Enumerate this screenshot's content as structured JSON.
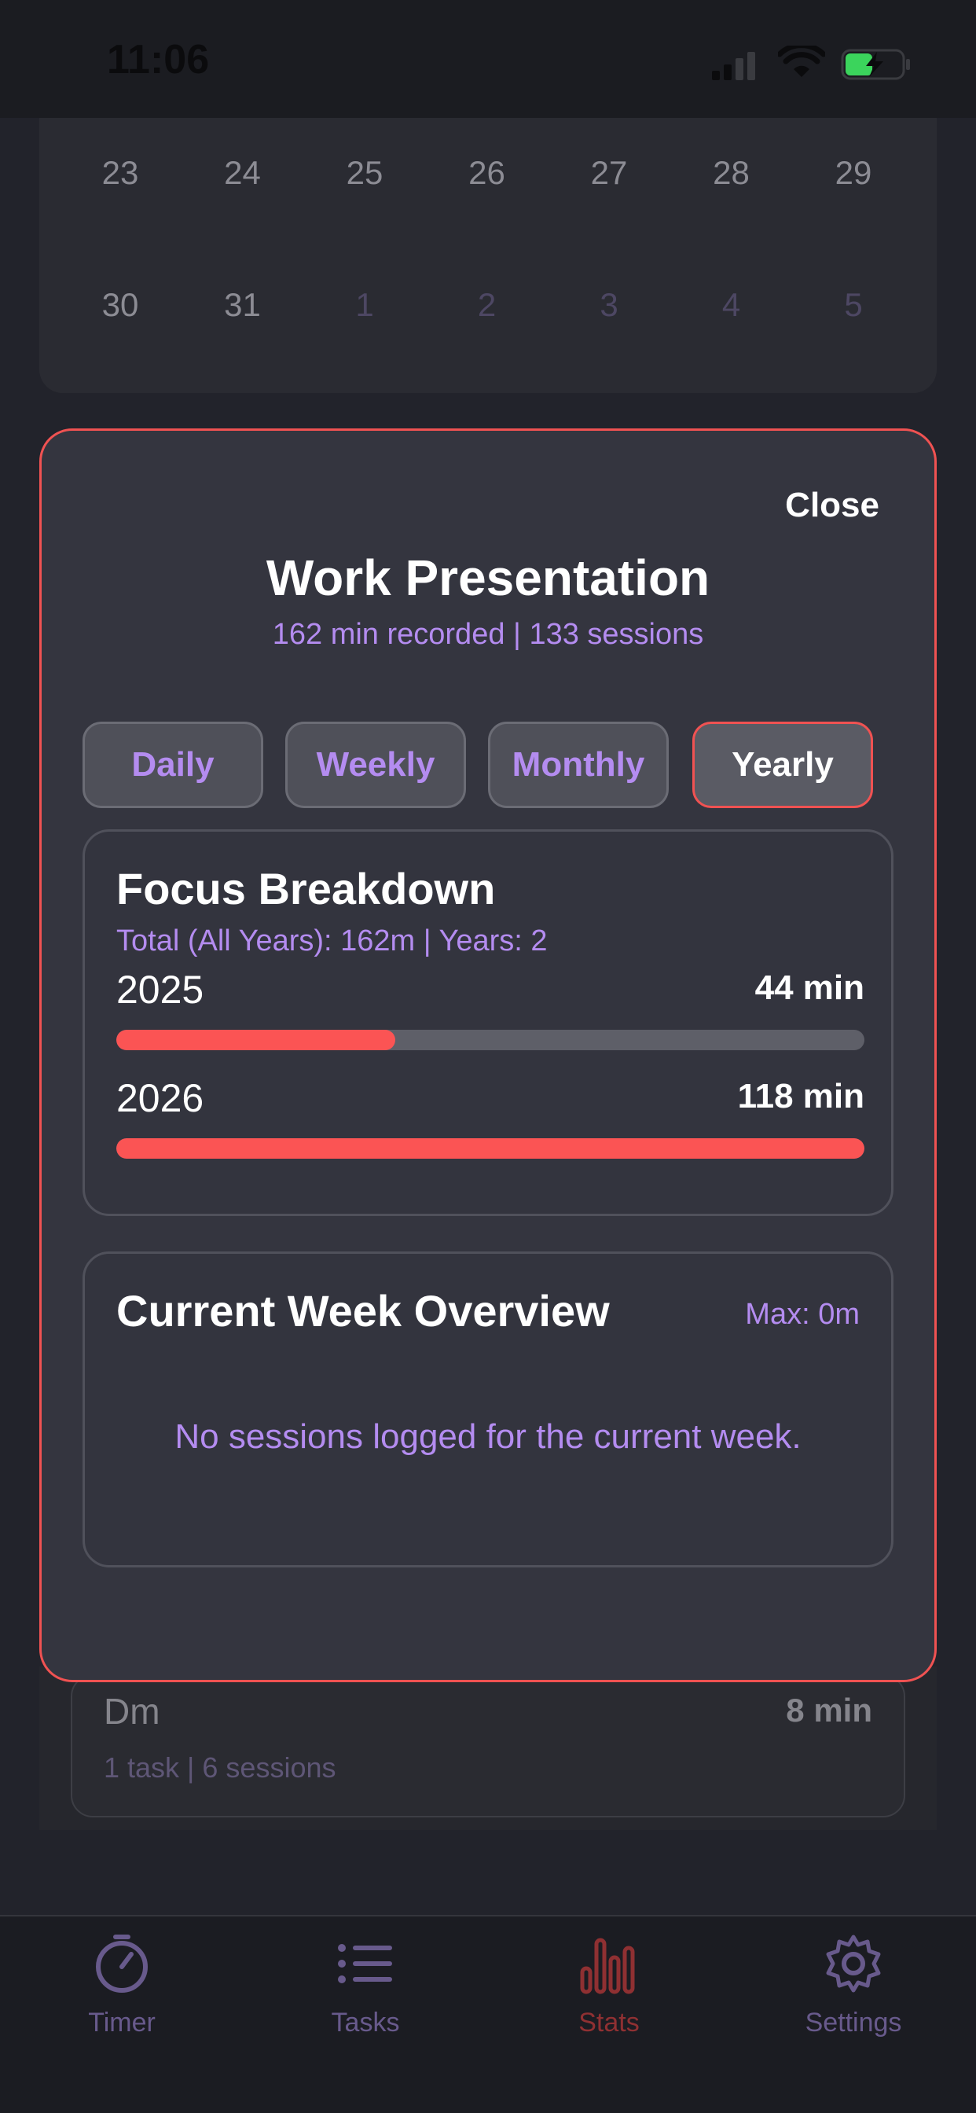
{
  "status": {
    "time": "11:06"
  },
  "calendar": {
    "rows": [
      [
        {
          "d": "23",
          "dim": false
        },
        {
          "d": "24",
          "dim": false
        },
        {
          "d": "25",
          "dim": false
        },
        {
          "d": "26",
          "dim": false
        },
        {
          "d": "27",
          "dim": false
        },
        {
          "d": "28",
          "dim": false
        },
        {
          "d": "29",
          "dim": false
        }
      ],
      [
        {
          "d": "30",
          "dim": false
        },
        {
          "d": "31",
          "dim": false
        },
        {
          "d": "1",
          "dim": true
        },
        {
          "d": "2",
          "dim": true
        },
        {
          "d": "3",
          "dim": true
        },
        {
          "d": "4",
          "dim": true
        },
        {
          "d": "5",
          "dim": true
        }
      ]
    ]
  },
  "background_item": {
    "name": "Dm",
    "minutes": "8 min",
    "subtitle": "1 task | 6 sessions"
  },
  "modal": {
    "close_label": "Close",
    "title": "Work Presentation",
    "subtitle": "162 min recorded | 133 sessions",
    "tabs": [
      {
        "label": "Daily",
        "active": false
      },
      {
        "label": "Weekly",
        "active": false
      },
      {
        "label": "Monthly",
        "active": false
      },
      {
        "label": "Yearly",
        "active": true
      }
    ],
    "focus": {
      "title": "Focus Breakdown",
      "summary": "Total (All Years): 162m | Years: 2",
      "years": [
        {
          "label": "2025",
          "value": "44 min",
          "fraction": 0.373
        },
        {
          "label": "2026",
          "value": "118 min",
          "fraction": 1.0
        }
      ]
    },
    "week": {
      "title": "Current Week Overview",
      "max_label": "Max: 0m",
      "empty_text": "No sessions logged for the current week."
    }
  },
  "tabbar": {
    "items": [
      {
        "label": "Timer",
        "icon": "timer-icon",
        "active": false
      },
      {
        "label": "Tasks",
        "icon": "list-icon",
        "active": false
      },
      {
        "label": "Stats",
        "icon": "bar-chart-icon",
        "active": true
      },
      {
        "label": "Settings",
        "icon": "gear-icon",
        "active": false
      }
    ]
  },
  "colors": {
    "accent_red": "#f05252",
    "accent_purple": "#b48cf0",
    "tab_active_red": "#8f3032",
    "tab_inactive_purple": "#685a8c"
  }
}
